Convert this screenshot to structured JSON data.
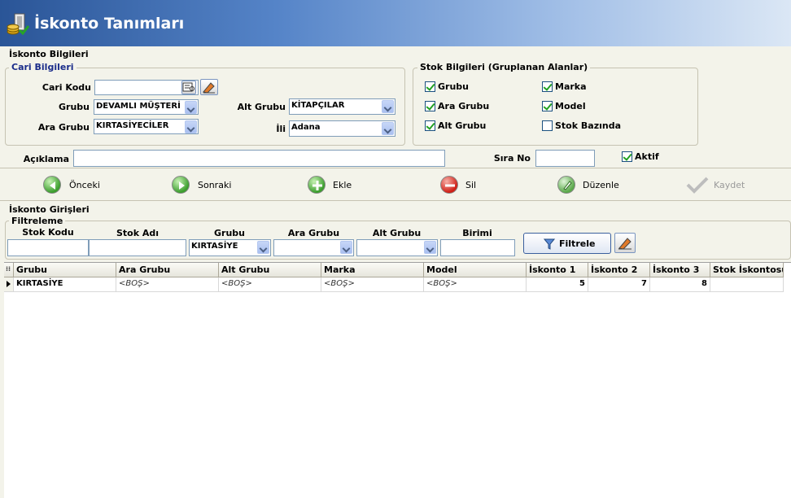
{
  "header": {
    "title": "İskonto Tanımları"
  },
  "section1": {
    "label": "İskonto Bilgileri"
  },
  "cari": {
    "legend": "Cari Bilgileri",
    "cari_kodu_label": "Cari Kodu",
    "cari_kodu_value": "",
    "grubu_label": "Grubu",
    "grubu_value": "DEVAMLI MÜŞTERİ",
    "ara_grubu_label": "Ara Grubu",
    "ara_grubu_value": "KIRTASİYECİLER",
    "alt_grubu_label": "Alt Grubu",
    "alt_grubu_value": "KİTAPÇILAR",
    "ili_label": "İli",
    "ili_value": "Adana"
  },
  "stok": {
    "legend": "Stok Bilgileri (Gruplanan Alanlar)",
    "checks": [
      {
        "label": "Grubu",
        "checked": true
      },
      {
        "label": "Marka",
        "checked": true
      },
      {
        "label": "Ara Grubu",
        "checked": true
      },
      {
        "label": "Model",
        "checked": true
      },
      {
        "label": "Alt Grubu",
        "checked": true
      },
      {
        "label": "Stok Bazında",
        "checked": false
      }
    ]
  },
  "aciklama": {
    "label": "Açıklama",
    "value": ""
  },
  "sira_no": {
    "label": "Sıra No",
    "value": ""
  },
  "aktif": {
    "label": "Aktif",
    "checked": true
  },
  "nav": {
    "onceki": "Önceki",
    "sonraki": "Sonraki",
    "ekle": "Ekle",
    "sil": "Sil",
    "duzenle": "Düzenle",
    "kaydet": "Kaydet"
  },
  "section2": {
    "label": "İskonto Girişleri"
  },
  "filter": {
    "label": "Filtreleme",
    "stok_kodu": "Stok Kodu",
    "stok_adi": "Stok Adı",
    "grubu": "Grubu",
    "grubu_value": "KIRTASİYE",
    "ara_grubu": "Ara Grubu",
    "alt_grubu": "Alt Grubu",
    "birimi": "Birimi",
    "filtrele_button": "Filtrele"
  },
  "grid": {
    "columns": [
      "Grubu",
      "Ara Grubu",
      "Alt Grubu",
      "Marka",
      "Model",
      "İskonto 1",
      "İskonto 2",
      "İskonto 3",
      "Stok İskontosu"
    ],
    "rows": [
      [
        "KIRTASİYE",
        "<BOŞ>",
        "<BOŞ>",
        "<BOŞ>",
        "<BOŞ>",
        "5",
        "7",
        "8",
        ""
      ]
    ]
  },
  "colors": {
    "header_start": "#2a5597",
    "header_end": "#dbe7f5",
    "background": "#f3f3ea"
  }
}
